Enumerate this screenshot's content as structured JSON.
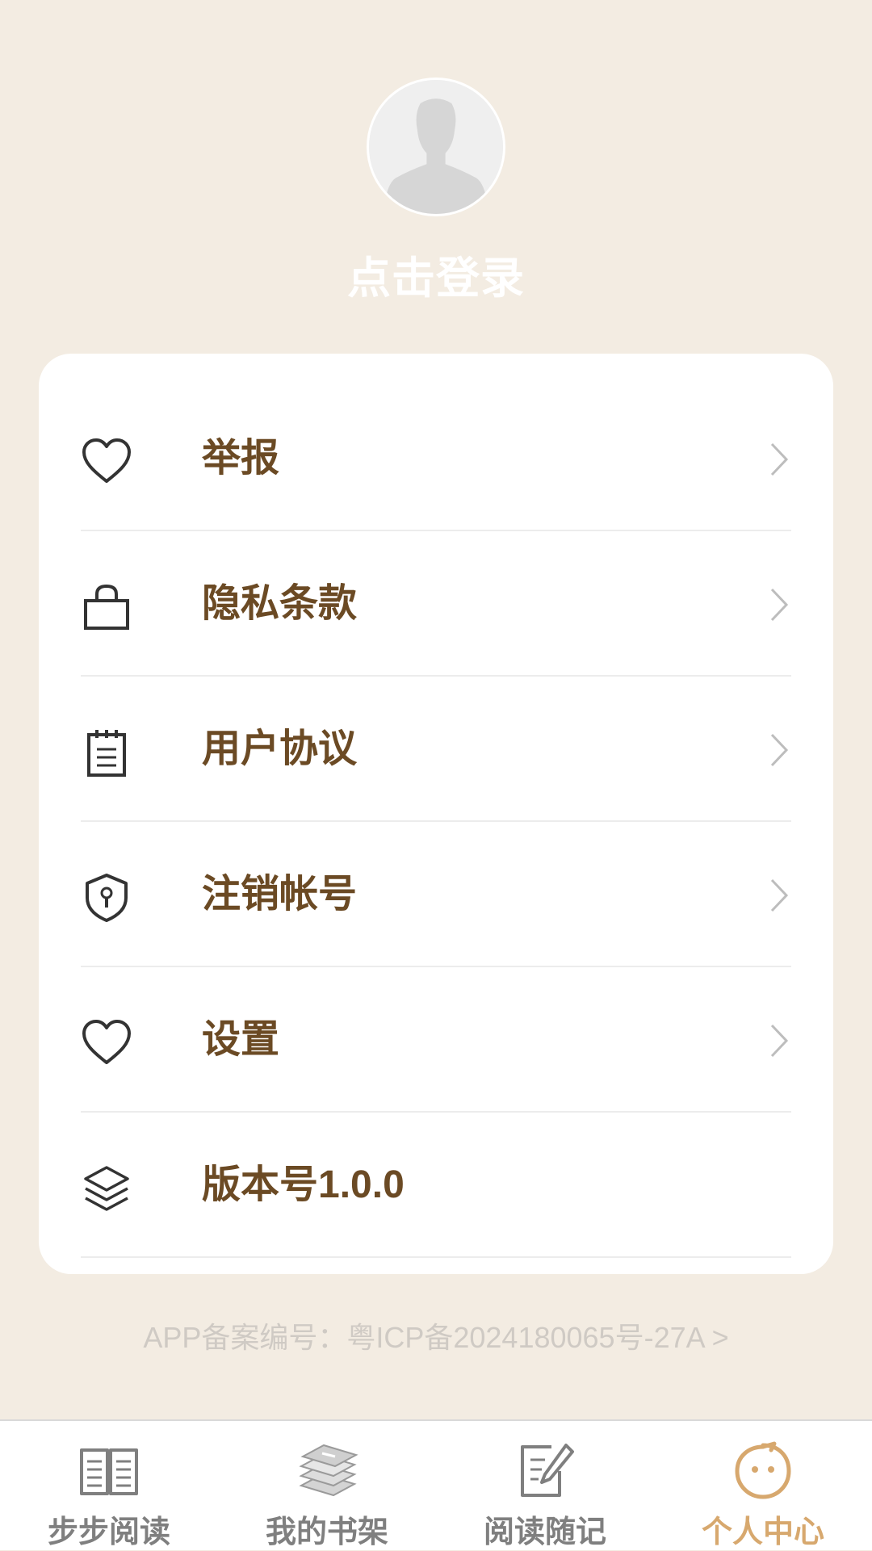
{
  "profile": {
    "login_label": "点击登录"
  },
  "menu": {
    "items": [
      {
        "label": "举报",
        "icon": "heart-icon"
      },
      {
        "label": "隐私条款",
        "icon": "bag-icon"
      },
      {
        "label": "用户协议",
        "icon": "notepad-icon"
      },
      {
        "label": "注销帐号",
        "icon": "shield-lock-icon"
      },
      {
        "label": "设置",
        "icon": "heart-icon"
      },
      {
        "label": "版本号1.0.0",
        "icon": "layers-icon"
      }
    ]
  },
  "footer": {
    "icp_text": "APP备案编号：粤ICP备2024180065号-27A >"
  },
  "tabbar": {
    "tabs": [
      {
        "label": "步步阅读",
        "icon": "open-book-icon"
      },
      {
        "label": "我的书架",
        "icon": "book-stack-icon"
      },
      {
        "label": "阅读随记",
        "icon": "edit-note-icon"
      },
      {
        "label": "个人中心",
        "icon": "smiley-face-icon",
        "active": true
      }
    ],
    "active_color": "#d7a86e",
    "inactive_color": "#7f7f7f"
  },
  "colors": {
    "background": "#f3ece2",
    "card": "#ffffff",
    "label_text": "#6b4a24"
  }
}
